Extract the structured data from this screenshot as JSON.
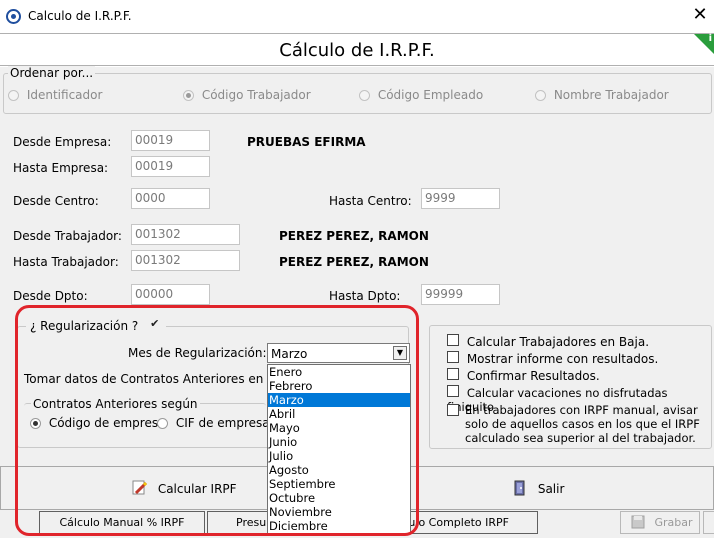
{
  "window": {
    "title": "Calculo de I.R.P.F.",
    "close": "✕"
  },
  "header": {
    "title": "Cálculo de I.R.P.F.",
    "badge": "i"
  },
  "ordenar": {
    "legend": "Ordenar por...",
    "options": [
      "Identificador",
      "Código Trabajador",
      "Código Empleado",
      "Nombre Trabajador"
    ],
    "selected": "Código Trabajador"
  },
  "fields": {
    "desde_empresa": {
      "label": "Desde Empresa:",
      "value": "00019",
      "name": "PRUEBAS EFIRMA"
    },
    "hasta_empresa": {
      "label": "Hasta Empresa:",
      "value": "00019"
    },
    "desde_centro": {
      "label": "Desde Centro:",
      "value": "0000"
    },
    "hasta_centro": {
      "label": "Hasta Centro:",
      "value": "9999"
    },
    "desde_trabajador": {
      "label": "Desde Trabajador:",
      "value": "001302",
      "name": "PEREZ PEREZ, RAMON"
    },
    "hasta_trabajador": {
      "label": "Hasta Trabajador:",
      "value": "001302",
      "name": "PEREZ PEREZ, RAMON"
    },
    "desde_dpto": {
      "label": "Desde Dpto:",
      "value": "00000"
    },
    "hasta_dpto": {
      "label": "Hasta Dpto:",
      "value": "99999"
    }
  },
  "regularizacion": {
    "legend": "¿ Regularización ?",
    "checked": true,
    "mes_label": "Mes de Regularización:",
    "mes_value": "Marzo",
    "tomar_label": "Tomar datos de Contratos Anteriores en cas",
    "contratos_legend": "Contratos Anteriores según",
    "contratos_options": [
      "Código de empresa",
      "CIF de empresa"
    ],
    "contratos_selected": "Código de empresa",
    "months": [
      "Enero",
      "Febrero",
      "Marzo",
      "Abril",
      "Mayo",
      "Junio",
      "Julio",
      "Agosto",
      "Septiembre",
      "Octubre",
      "Noviembre",
      "Diciembre"
    ]
  },
  "options": [
    {
      "label": "Calcular Trabajadores en Baja.",
      "checked": false
    },
    {
      "label": "Mostrar informe con resultados.",
      "checked": false
    },
    {
      "label": "Confirmar Resultados.",
      "checked": false
    },
    {
      "label": "Calcular vacaciones no disfrutadas finiquito",
      "checked": false
    },
    {
      "label": "En trabajadores con IRPF manual, avisar solo de aquellos casos en los que el IRPF calculado sea superior al del trabajador.",
      "checked": false
    }
  ],
  "buttons": {
    "calcular": "Calcular IRPF",
    "salir": "Salir",
    "grabar": "Grabar"
  },
  "bottom_tabs": [
    "Cálculo Manual % IRPF",
    "Presu",
    "lculo Completo IRPF"
  ],
  "colors": {
    "highlight": "#e0242b",
    "selection": "#0078d7",
    "badge": "#2a9d3c"
  }
}
